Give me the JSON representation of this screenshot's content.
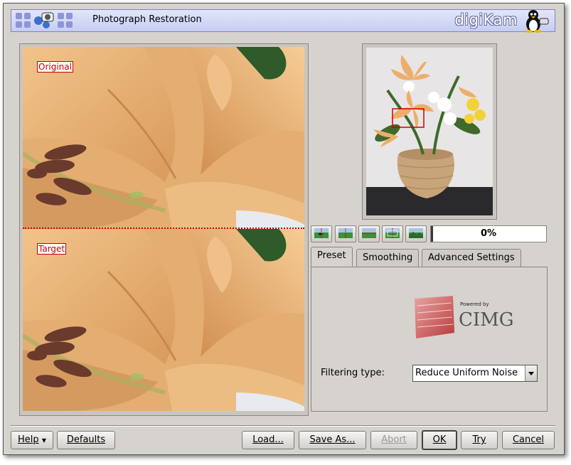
{
  "banner": {
    "title": "Photograph Restoration",
    "brand": "digiKam"
  },
  "preview": {
    "original_label": "Original",
    "target_label": "Target"
  },
  "progress": {
    "value": 0,
    "text": "0%"
  },
  "tabs": [
    {
      "label": "Preset",
      "active": true
    },
    {
      "label": "Smoothing",
      "active": false
    },
    {
      "label": "Advanced Settings",
      "active": false
    }
  ],
  "preset": {
    "powered_by": "Powered by",
    "logo_text": "CIMG",
    "filtering_label": "Filtering type:",
    "filtering_value": "Reduce Uniform Noise"
  },
  "buttons": {
    "help": "Help",
    "defaults": "Defaults",
    "load": "Load...",
    "save_as": "Save As...",
    "abort": "Abort",
    "ok": "OK",
    "try": "Try",
    "cancel": "Cancel"
  },
  "colors": {
    "banner": "#d4daf6",
    "marker": "#cc0000",
    "petal": "#e8b87a"
  }
}
